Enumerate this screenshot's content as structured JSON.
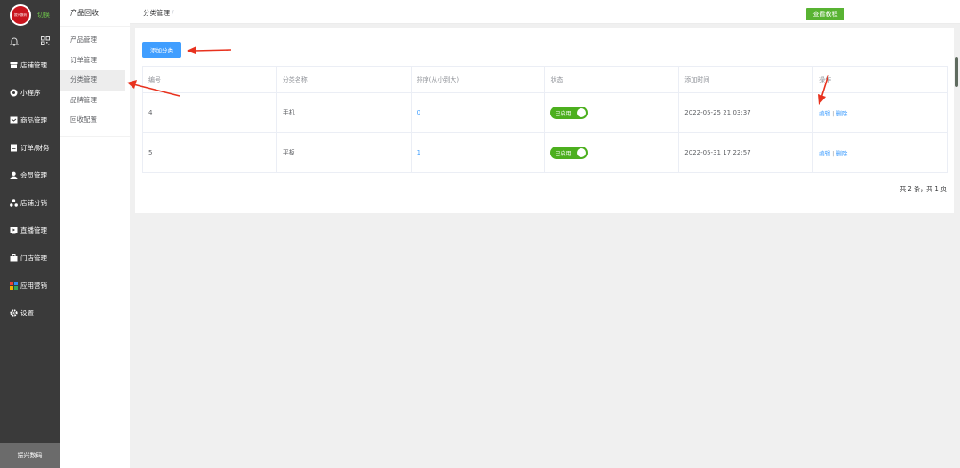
{
  "brand": {
    "logo_text": "振兴数码",
    "switch_label": "切换",
    "footer": "振兴数码"
  },
  "nav": [
    {
      "icon": "shop-icon",
      "label": "店铺管理"
    },
    {
      "icon": "miniprogram-icon",
      "label": "小程序"
    },
    {
      "icon": "goods-icon",
      "label": "商品管理"
    },
    {
      "icon": "order-icon",
      "label": "订单/财务"
    },
    {
      "icon": "member-icon",
      "label": "会员管理"
    },
    {
      "icon": "distribution-icon",
      "label": "店铺分销"
    },
    {
      "icon": "live-icon",
      "label": "直播管理"
    },
    {
      "icon": "store-icon",
      "label": "门店管理"
    },
    {
      "icon": "apps-icon",
      "label": "应用营销"
    },
    {
      "icon": "gear-icon",
      "label": "设置"
    }
  ],
  "sub_menu": {
    "title": "产品回收",
    "items": [
      "产品管理",
      "订单管理",
      "分类管理",
      "品牌管理",
      "回收配置"
    ],
    "active_index": 2
  },
  "header": {
    "breadcrumb": "分类管理",
    "breadcrumb_sep": "/",
    "tutorial_button": "查看教程"
  },
  "toolbar": {
    "add_button": "添加分类"
  },
  "table": {
    "columns": [
      "编号",
      "分类名称",
      "排序(从小到大)",
      "状态",
      "添加时间",
      "操作"
    ],
    "rows": [
      {
        "id": "4",
        "name": "手机",
        "sort": "0",
        "status": "已启用",
        "time": "2022-05-25 21:03:37",
        "edit": "编辑",
        "delete": "删除"
      },
      {
        "id": "5",
        "name": "平板",
        "sort": "1",
        "status": "已启用",
        "time": "2022-05-31 17:22:57",
        "edit": "编辑",
        "delete": "删除"
      }
    ],
    "action_sep": "|"
  },
  "pagination": {
    "summary": "共 2 条，共 1 页"
  },
  "colors": {
    "accent": "#409eff",
    "success": "#4caf1e",
    "sidebar": "#3a3a3a",
    "arrow": "#e8321e"
  }
}
